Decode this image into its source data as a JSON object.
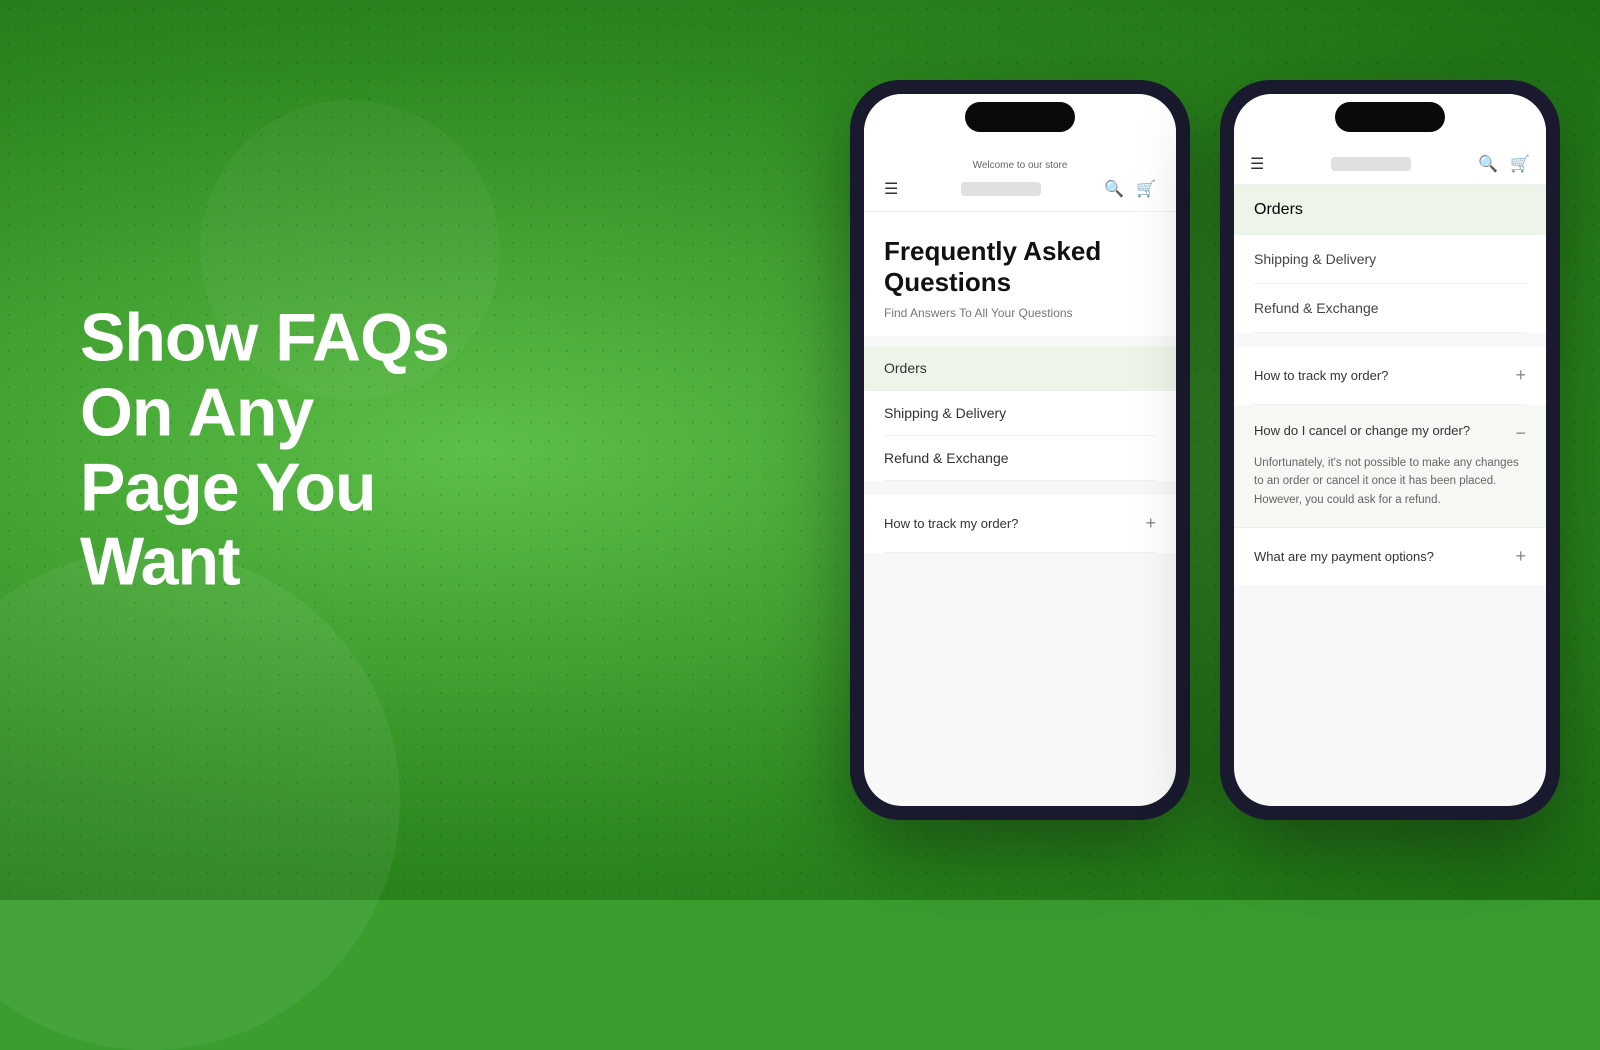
{
  "background": {
    "primary_color": "#3a9e2f",
    "secondary_color": "#5cbf47"
  },
  "left_section": {
    "headline_line1": "Show FAQs",
    "headline_line2": "On Any",
    "headline_line3": "Page You",
    "headline_line4": "Want"
  },
  "phone1": {
    "welcome_text": "Welcome to our store",
    "logo_placeholder": "",
    "faq_title": "Frequently Asked Questions",
    "faq_subtitle": "Find Answers To All Your Questions",
    "categories": [
      {
        "label": "Orders",
        "active": true
      },
      {
        "label": "Shipping & Delivery",
        "active": false
      },
      {
        "label": "Refund & Exchange",
        "active": false
      }
    ],
    "faq_items": [
      {
        "question": "How to track my order?",
        "expanded": false
      }
    ]
  },
  "phone2": {
    "categories": [
      {
        "label": "Orders",
        "active": true
      },
      {
        "label": "Shipping & Delivery",
        "active": false
      },
      {
        "label": "Refund & Exchange",
        "active": false
      }
    ],
    "faq_items": [
      {
        "question": "How to track my order?",
        "expanded": false,
        "answer": ""
      },
      {
        "question": "How do I cancel or change my order?",
        "expanded": true,
        "answer": "Unfortunately, it's not possible to make any changes to an order or cancel it once it has been placed. However, you could ask for a refund."
      },
      {
        "question": "What are my payment options?",
        "expanded": false,
        "answer": ""
      }
    ]
  },
  "icons": {
    "hamburger": "☰",
    "search": "🔍",
    "cart": "🛍",
    "plus": "+",
    "minus": "−"
  }
}
